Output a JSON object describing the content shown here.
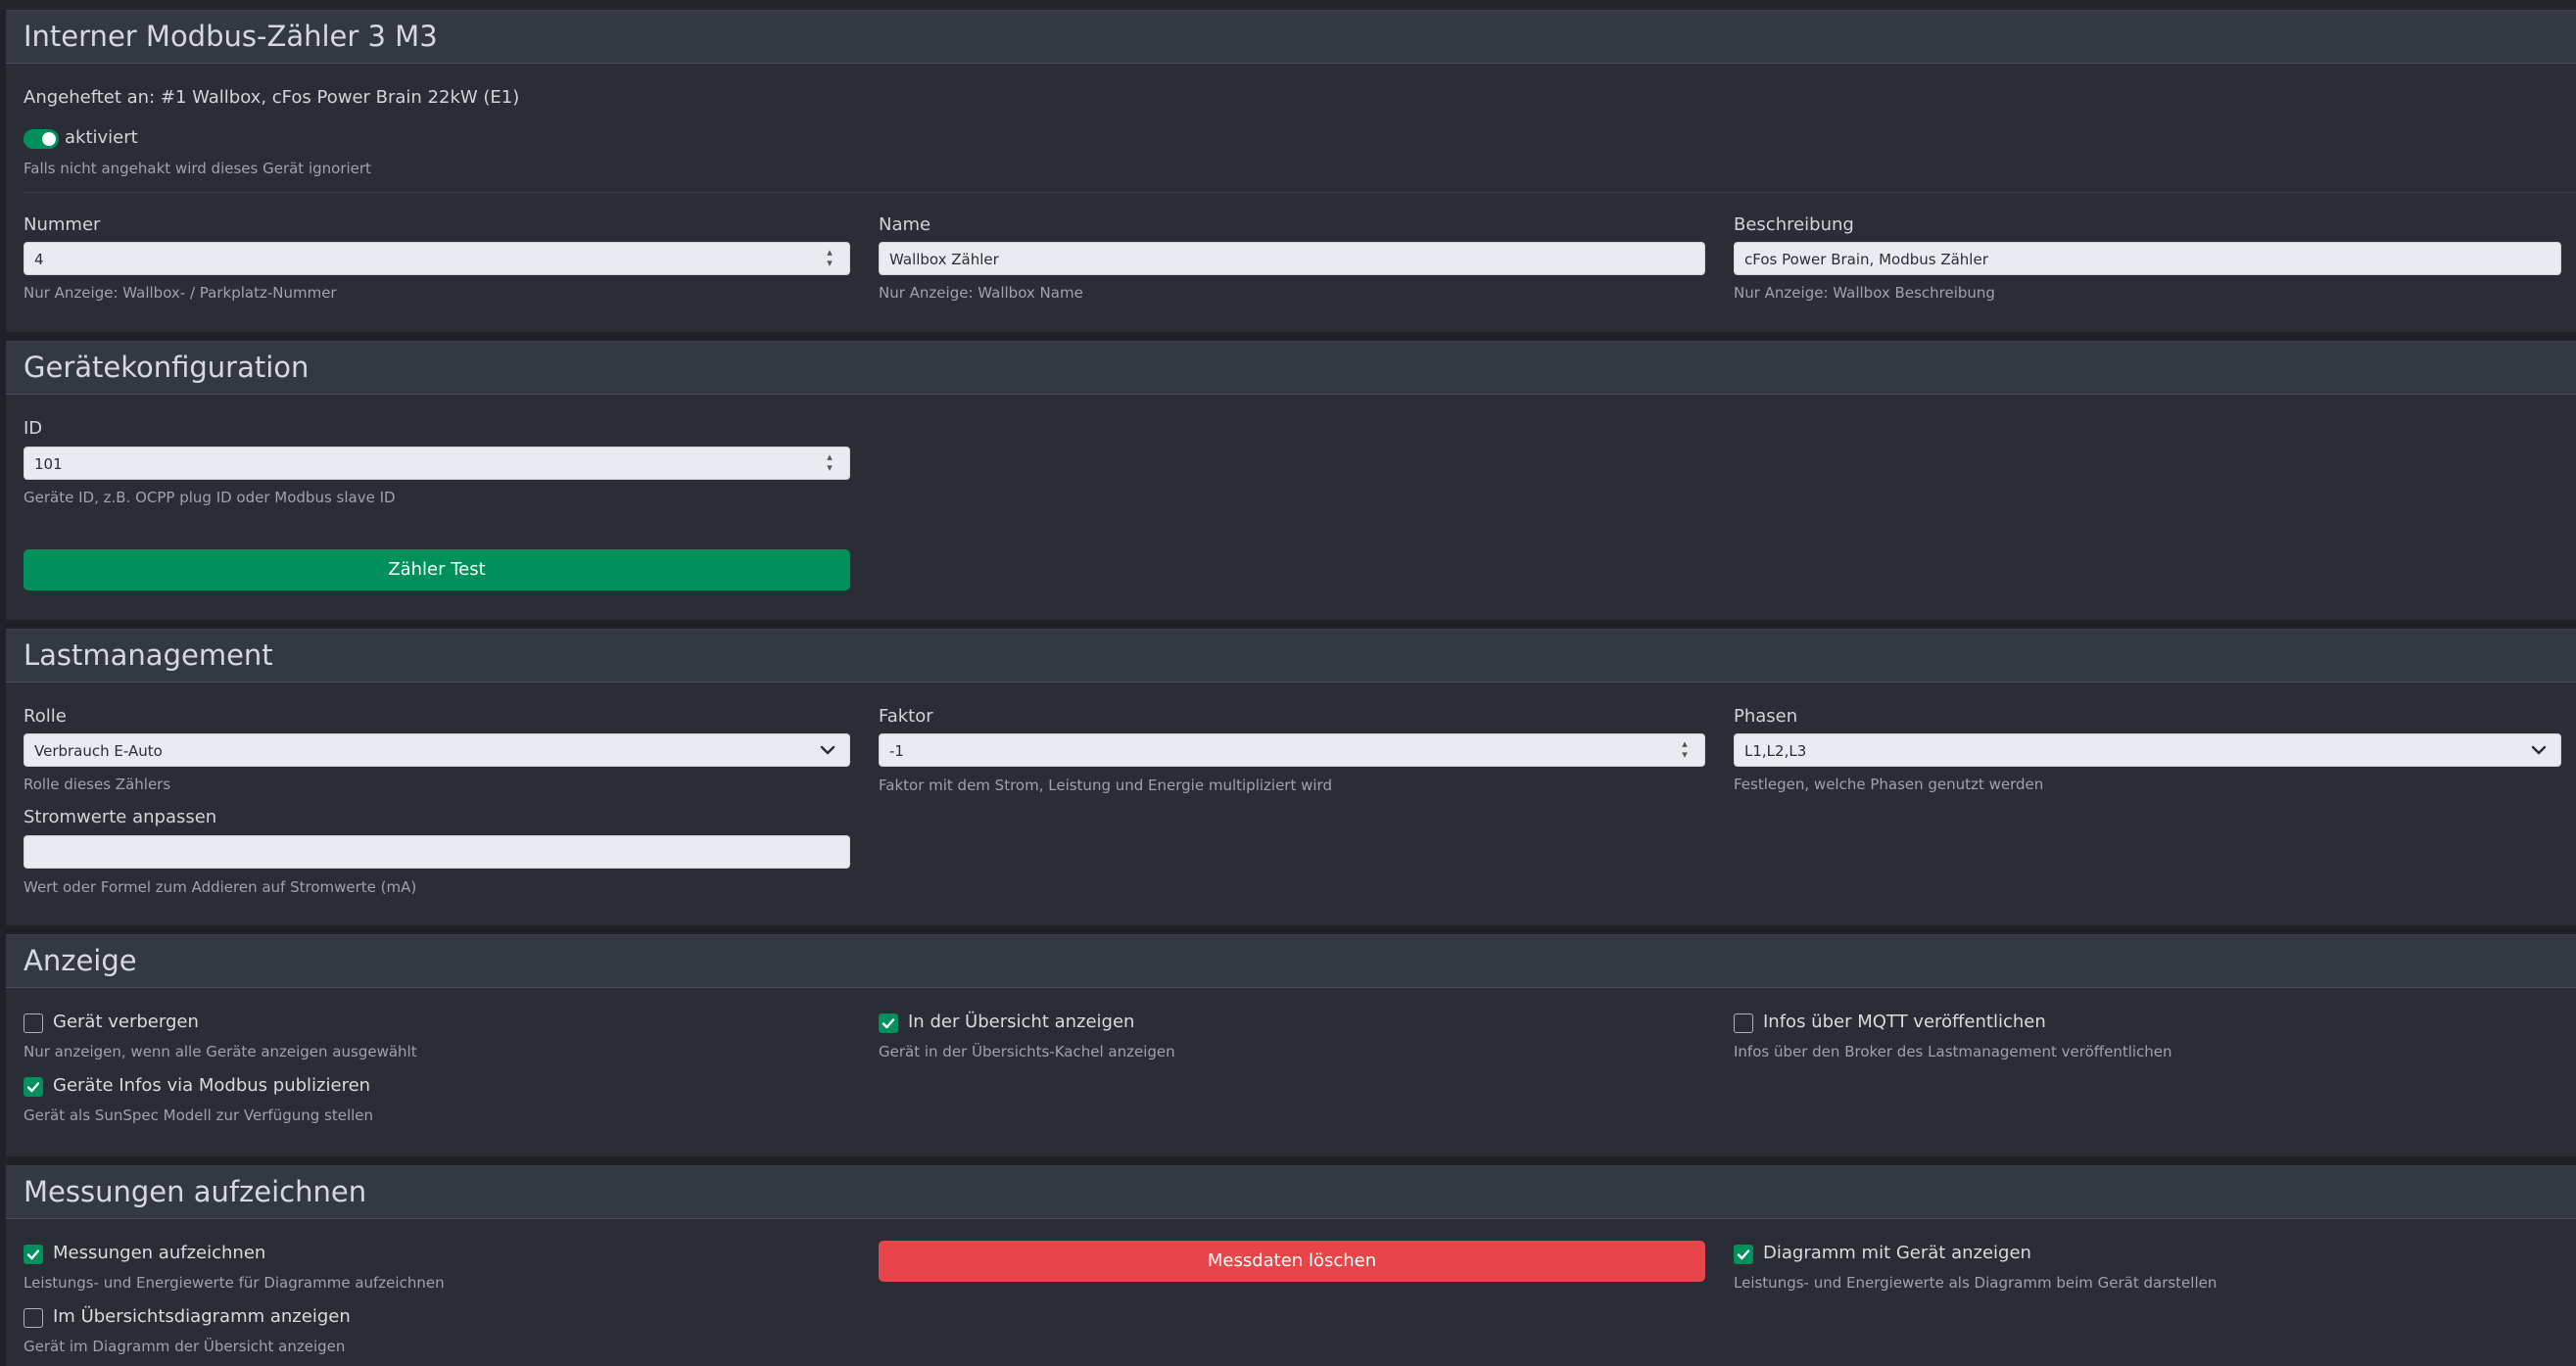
{
  "section1": {
    "title": "Interner Modbus-Zähler 3 M3",
    "attached": "Angeheftet an: #1 Wallbox, cFos Power Brain 22kW (E1)",
    "active_label": "aktiviert",
    "active_help": "Falls nicht angehakt wird dieses Gerät ignoriert",
    "active_on": true,
    "nummer": {
      "label": "Nummer",
      "value": "4",
      "help": "Nur Anzeige: Wallbox- / Parkplatz-Nummer"
    },
    "name": {
      "label": "Name",
      "value": "Wallbox Zähler",
      "help": "Nur Anzeige: Wallbox Name"
    },
    "beschreibung": {
      "label": "Beschreibung",
      "value": "cFos Power Brain, Modbus Zähler",
      "help": "Nur Anzeige: Wallbox Beschreibung"
    }
  },
  "section2": {
    "title": "Gerätekonfiguration",
    "id": {
      "label": "ID",
      "value": "101",
      "help": "Geräte ID, z.B. OCPP plug ID oder Modbus slave ID"
    },
    "test_button": "Zähler Test"
  },
  "section3": {
    "title": "Lastmanagement",
    "rolle": {
      "label": "Rolle",
      "value": "Verbrauch E-Auto",
      "help": "Rolle dieses Zählers"
    },
    "faktor": {
      "label": "Faktor",
      "value": "-1",
      "help": "Faktor mit dem Strom, Leistung und Energie multipliziert wird"
    },
    "phasen": {
      "label": "Phasen",
      "value": "L1,L2,L3",
      "help": "Festlegen, welche Phasen genutzt werden"
    },
    "strom": {
      "label": "Stromwerte anpassen",
      "value": "",
      "help": "Wert oder Formel zum Addieren auf Stromwerte (mA)"
    }
  },
  "section4": {
    "title": "Anzeige",
    "hide": {
      "label": "Gerät verbergen",
      "help": "Nur anzeigen, wenn alle Geräte anzeigen ausgewählt",
      "checked": false
    },
    "overview": {
      "label": "In der Übersicht anzeigen",
      "help": "Gerät in der Übersichts-Kachel anzeigen",
      "checked": true
    },
    "mqtt": {
      "label": "Infos über MQTT veröffentlichen",
      "help": "Infos über den Broker des Lastmanagement veröffentlichen",
      "checked": false
    },
    "modbus": {
      "label": "Geräte Infos via Modbus publizieren",
      "help": "Gerät als SunSpec Modell zur Verfügung stellen",
      "checked": true
    }
  },
  "section5": {
    "title": "Messungen aufzeichnen",
    "record": {
      "label": "Messungen aufzeichnen",
      "help": "Leistungs- und Energiewerte für Diagramme aufzeichnen",
      "checked": true
    },
    "delete_button": "Messdaten löschen",
    "chart": {
      "label": "Diagramm mit Gerät anzeigen",
      "help": "Leistungs- und Energiewerte als Diagramm beim Gerät darstellen",
      "checked": true
    },
    "overview_chart": {
      "label": "Im Übersichtsdiagramm anzeigen",
      "help": "Gerät im Diagramm der Übersicht anzeigen",
      "checked": false
    }
  },
  "colors": {
    "accent": "#00905c",
    "danger": "#e74549",
    "background": "#1f2129",
    "card": "#2a2d36"
  },
  "icons": {
    "spinner": "spinner-arrows-icon",
    "select": "chevron-down-icon",
    "check": "checkmark-icon"
  }
}
